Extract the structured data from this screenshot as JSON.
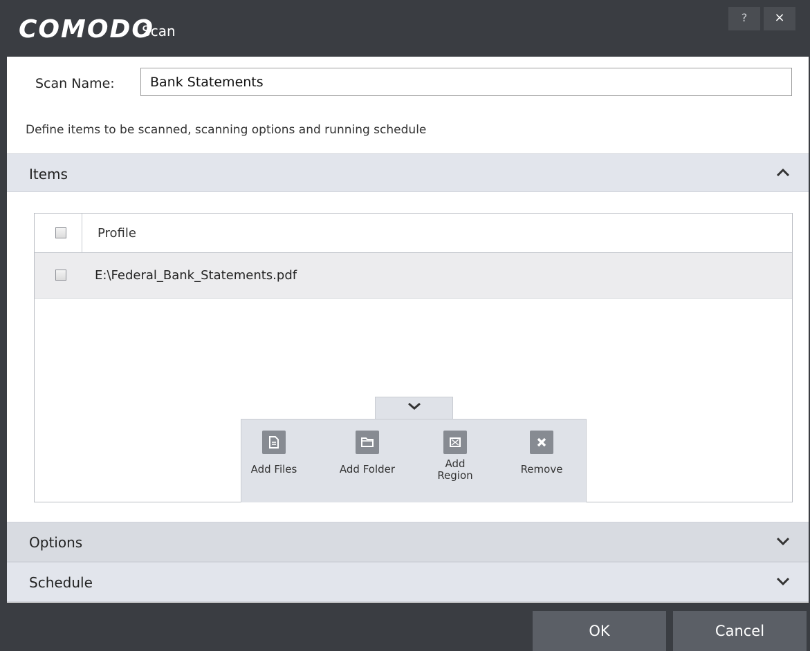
{
  "window": {
    "brand": "COMODO",
    "title": "Scan",
    "help_label": "?",
    "close_label": "×"
  },
  "form": {
    "scan_name_label": "Scan Name:",
    "scan_name_value": "Bank Statements",
    "description": "Define items to be scanned, scanning options and running schedule"
  },
  "sections": {
    "items": {
      "label": "Items",
      "expanded": true
    },
    "options": {
      "label": "Options",
      "expanded": false
    },
    "schedule": {
      "label": "Schedule",
      "expanded": false
    }
  },
  "items_table": {
    "column_header": "Profile",
    "rows": [
      {
        "path": "E:\\Federal_Bank_Statements.pdf",
        "checked": false
      }
    ]
  },
  "actions": [
    {
      "label": "Add Files",
      "icon": "file-icon"
    },
    {
      "label": "Add Folder",
      "icon": "folder-icon"
    },
    {
      "label": "Add Region",
      "icon": "region-icon"
    },
    {
      "label": "Remove",
      "icon": "remove-icon"
    }
  ],
  "footer": {
    "ok_label": "OK",
    "cancel_label": "Cancel"
  },
  "colors": {
    "title_bar": "#3a3d42",
    "section_header": "#e2e5ec",
    "button": "#5b5f66"
  }
}
